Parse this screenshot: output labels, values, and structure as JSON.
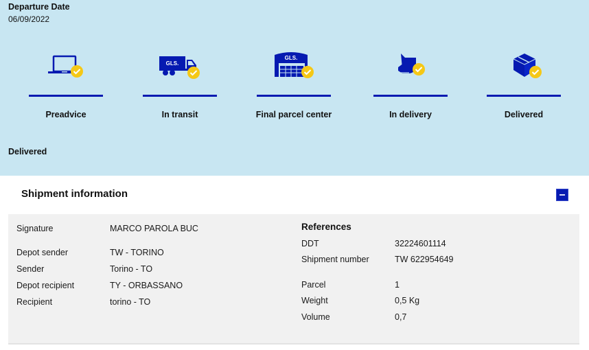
{
  "departure": {
    "label": "Departure Date",
    "value": "06/09/2022"
  },
  "steps": [
    {
      "label": "Preadvice",
      "icon": "laptop-icon",
      "completed": true
    },
    {
      "label": "In transit",
      "icon": "truck-icon",
      "completed": true,
      "icon_text": "GLS."
    },
    {
      "label": "Final parcel center",
      "icon": "warehouse-icon",
      "completed": true,
      "icon_text": "GLS."
    },
    {
      "label": "In delivery",
      "icon": "hand-parcel-icon",
      "completed": true
    },
    {
      "label": "Delivered",
      "icon": "box-icon",
      "completed": true
    }
  ],
  "status": "Delivered",
  "shipment": {
    "title": "Shipment information",
    "collapse_icon": "minus-icon",
    "left": [
      {
        "label": "Signature",
        "value": "MARCO PAROLA BUC"
      },
      {
        "label": "Depot sender",
        "value": "TW - TORINO"
      },
      {
        "label": "Sender",
        "value": "Torino - TO"
      },
      {
        "label": "Depot recipient",
        "value": "TY - ORBASSANO"
      },
      {
        "label": "Recipient",
        "value": "torino - TO"
      }
    ],
    "references_title": "References",
    "right": [
      {
        "label": "DDT",
        "value": "32224601114"
      },
      {
        "label": "Shipment number",
        "value": "TW 622954649"
      },
      {
        "label": "Parcel",
        "value": "1"
      },
      {
        "label": "Weight",
        "value": "0,5 Kg"
      },
      {
        "label": "Volume",
        "value": "0,7"
      }
    ]
  },
  "colors": {
    "panel_bg": "#c8e6f2",
    "brand_blue": "#061ab1",
    "check_yellow": "#f5c816",
    "info_bg": "#f1f1f1"
  }
}
